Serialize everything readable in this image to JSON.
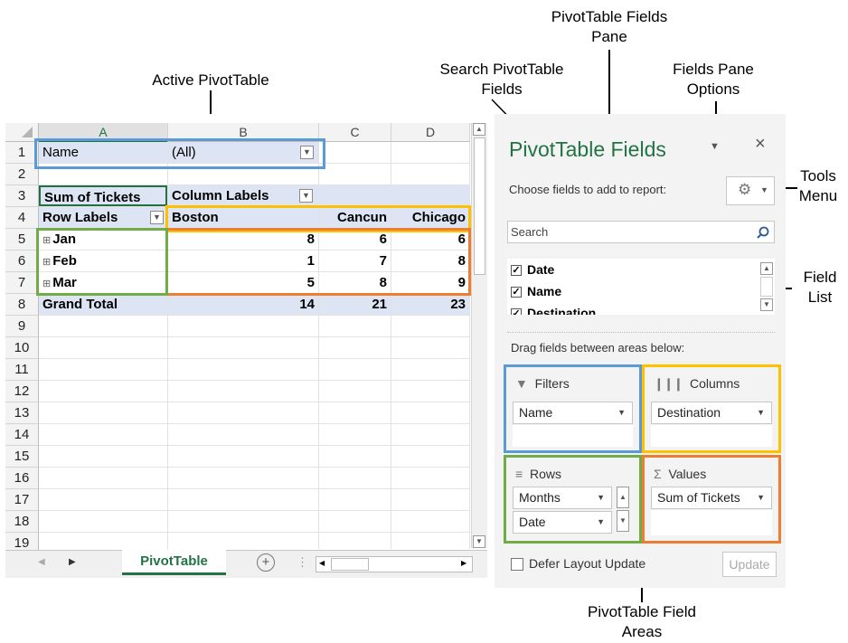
{
  "callouts": {
    "pane": "PivotTable Fields\nPane",
    "active": "Active PivotTable",
    "search": "Search PivotTable\nFields",
    "options": "Fields Pane\nOptions",
    "tools": "Tools\nMenu",
    "field_list": "Field\nList",
    "areas": "PivotTable Field\nAreas"
  },
  "sheet": {
    "columns": [
      "A",
      "B",
      "C",
      "D"
    ],
    "rows": [
      "1",
      "2",
      "3",
      "4",
      "5",
      "6",
      "7",
      "8",
      "9",
      "10",
      "11",
      "12",
      "13",
      "14",
      "15",
      "16",
      "17",
      "18",
      "19"
    ],
    "filter_label": "Name",
    "filter_value": "(All)",
    "sum_label": "Sum of Tickets",
    "column_labels": "Column Labels",
    "row_labels": "Row Labels",
    "destinations": [
      "Boston",
      "Cancun",
      "Chicago"
    ],
    "data_rows": [
      {
        "label": "Jan",
        "values": [
          "8",
          "6",
          "6"
        ]
      },
      {
        "label": "Feb",
        "values": [
          "1",
          "7",
          "8"
        ]
      },
      {
        "label": "Mar",
        "values": [
          "5",
          "8",
          "9"
        ]
      }
    ],
    "grand_total_label": "Grand Total",
    "grand_totals": [
      "14",
      "21",
      "23"
    ],
    "sheet_tab": "PivotTable"
  },
  "pane": {
    "title": "PivotTable Fields",
    "choose": "Choose fields to add to report:",
    "search_placeholder": "Search",
    "fields": [
      {
        "name": "Date",
        "checked": true
      },
      {
        "name": "Name",
        "checked": true
      },
      {
        "name": "Destination",
        "checked": true
      }
    ],
    "drag_hint": "Drag fields between areas below:",
    "filters_label": "Filters",
    "filters_item": "Name",
    "columns_label": "Columns",
    "columns_item": "Destination",
    "rows_label": "Rows",
    "rows_items": [
      "Months",
      "Date"
    ],
    "values_label": "Values",
    "values_item": "Sum of Tickets",
    "defer_label": "Defer Layout Update",
    "update_label": "Update"
  },
  "colors": {
    "blue": "#5b9bd5",
    "orange": "#ed7d31",
    "green": "#70ad47",
    "yellow": "#ffc000",
    "excel_green": "#217346"
  }
}
